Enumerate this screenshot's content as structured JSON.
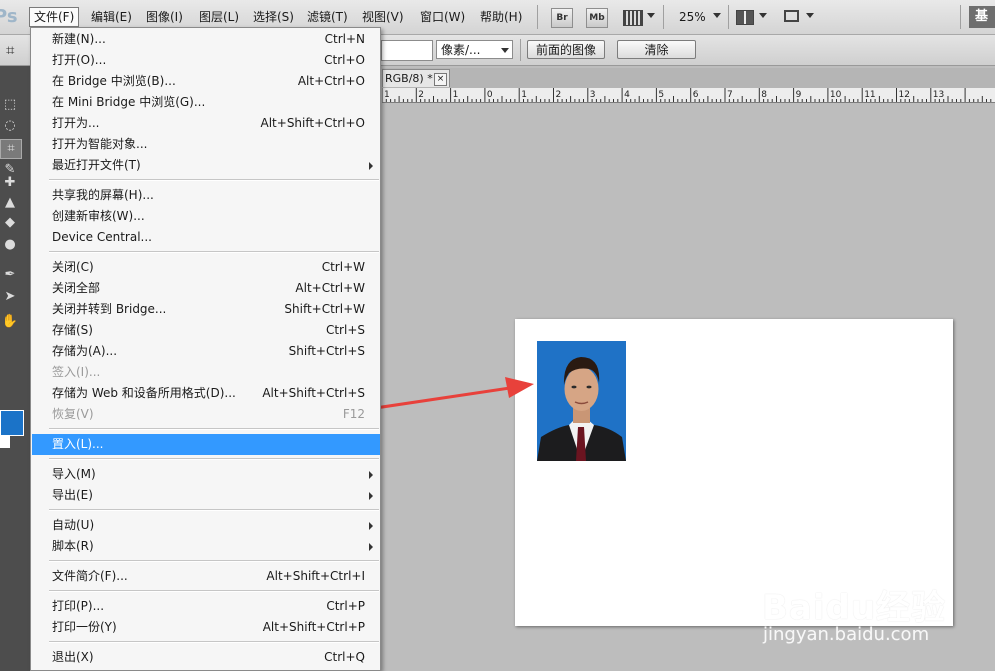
{
  "app": {
    "logo_text": "Ps"
  },
  "menubar": {
    "items": [
      {
        "label": "文件(F)",
        "active": true
      },
      {
        "label": "编辑(E)"
      },
      {
        "label": "图像(I)"
      },
      {
        "label": "图层(L)"
      },
      {
        "label": "选择(S)"
      },
      {
        "label": "滤镜(T)"
      },
      {
        "label": "视图(V)"
      },
      {
        "label": "窗口(W)"
      },
      {
        "label": "帮助(H)"
      }
    ],
    "bridge_btn": "Br",
    "minibridge_btn": "Mb",
    "zoom": "25%",
    "workspace_label": "基"
  },
  "options_bar": {
    "units_select": "像素/...",
    "front_image_btn": "前面的图像",
    "clear_btn": "清除"
  },
  "document_tab": {
    "label": "RGB/8) *",
    "close": "×"
  },
  "ruler": {
    "labels": [
      "1",
      "2",
      "1",
      "0",
      "1",
      "2",
      "3",
      "4",
      "5",
      "6",
      "7",
      "8",
      "9",
      "10",
      "11",
      "12",
      "13"
    ]
  },
  "file_menu": {
    "items": [
      {
        "label": "新建(N)...",
        "shortcut": "Ctrl+N"
      },
      {
        "label": "打开(O)...",
        "shortcut": "Ctrl+O"
      },
      {
        "label": "在 Bridge 中浏览(B)...",
        "shortcut": "Alt+Ctrl+O"
      },
      {
        "label": "在 Mini Bridge 中浏览(G)...",
        "shortcut": ""
      },
      {
        "label": "打开为...",
        "shortcut": "Alt+Shift+Ctrl+O"
      },
      {
        "label": "打开为智能对象...",
        "shortcut": ""
      },
      {
        "label": "最近打开文件(T)",
        "shortcut": "",
        "submenu": true
      },
      {
        "separator": true
      },
      {
        "label": "共享我的屏幕(H)...",
        "shortcut": ""
      },
      {
        "label": "创建新审核(W)...",
        "shortcut": ""
      },
      {
        "label": "Device Central...",
        "shortcut": ""
      },
      {
        "separator": true
      },
      {
        "label": "关闭(C)",
        "shortcut": "Ctrl+W"
      },
      {
        "label": "关闭全部",
        "shortcut": "Alt+Ctrl+W"
      },
      {
        "label": "关闭并转到 Bridge...",
        "shortcut": "Shift+Ctrl+W"
      },
      {
        "label": "存储(S)",
        "shortcut": "Ctrl+S"
      },
      {
        "label": "存储为(A)...",
        "shortcut": "Shift+Ctrl+S"
      },
      {
        "label": "签入(I)...",
        "shortcut": "",
        "disabled": true
      },
      {
        "label": "存储为 Web 和设备所用格式(D)...",
        "shortcut": "Alt+Shift+Ctrl+S"
      },
      {
        "label": "恢复(V)",
        "shortcut": "F12",
        "disabled": true
      },
      {
        "separator": true
      },
      {
        "label": "置入(L)...",
        "shortcut": "",
        "highlight": true
      },
      {
        "separator": true
      },
      {
        "label": "导入(M)",
        "shortcut": "",
        "submenu": true
      },
      {
        "label": "导出(E)",
        "shortcut": "",
        "submenu": true
      },
      {
        "separator": true
      },
      {
        "label": "自动(U)",
        "shortcut": "",
        "submenu": true
      },
      {
        "label": "脚本(R)",
        "shortcut": "",
        "submenu": true
      },
      {
        "separator": true
      },
      {
        "label": "文件简介(F)...",
        "shortcut": "Alt+Shift+Ctrl+I"
      },
      {
        "separator": true
      },
      {
        "label": "打印(P)...",
        "shortcut": "Ctrl+P"
      },
      {
        "label": "打印一份(Y)",
        "shortcut": "Alt+Shift+Ctrl+P"
      },
      {
        "separator": true
      },
      {
        "label": "退出(X)",
        "shortcut": "Ctrl+Q"
      }
    ]
  },
  "toolbox": {
    "tools": [
      "marquee-icon",
      "lasso-icon",
      "crop-icon",
      "eyedropper-icon",
      "healing-brush-icon",
      "brush-icon",
      "clone-stamp-icon",
      "history-brush-icon",
      "eraser-icon",
      "gradient-icon",
      "blur-icon",
      "dodge-icon",
      "pen-icon",
      "type-icon",
      "path-select-icon",
      "shape-icon",
      "hand-icon",
      "zoom-icon"
    ],
    "foreground_color": "#1b73c8",
    "background_color": "#ffffff"
  },
  "watermark": {
    "logo": "Baidu经验",
    "url": "jingyan.baidu.com"
  },
  "colors": {
    "highlight": "#3399ff",
    "arrow": "#e8413b",
    "photo_bg": "#1f72c6"
  }
}
